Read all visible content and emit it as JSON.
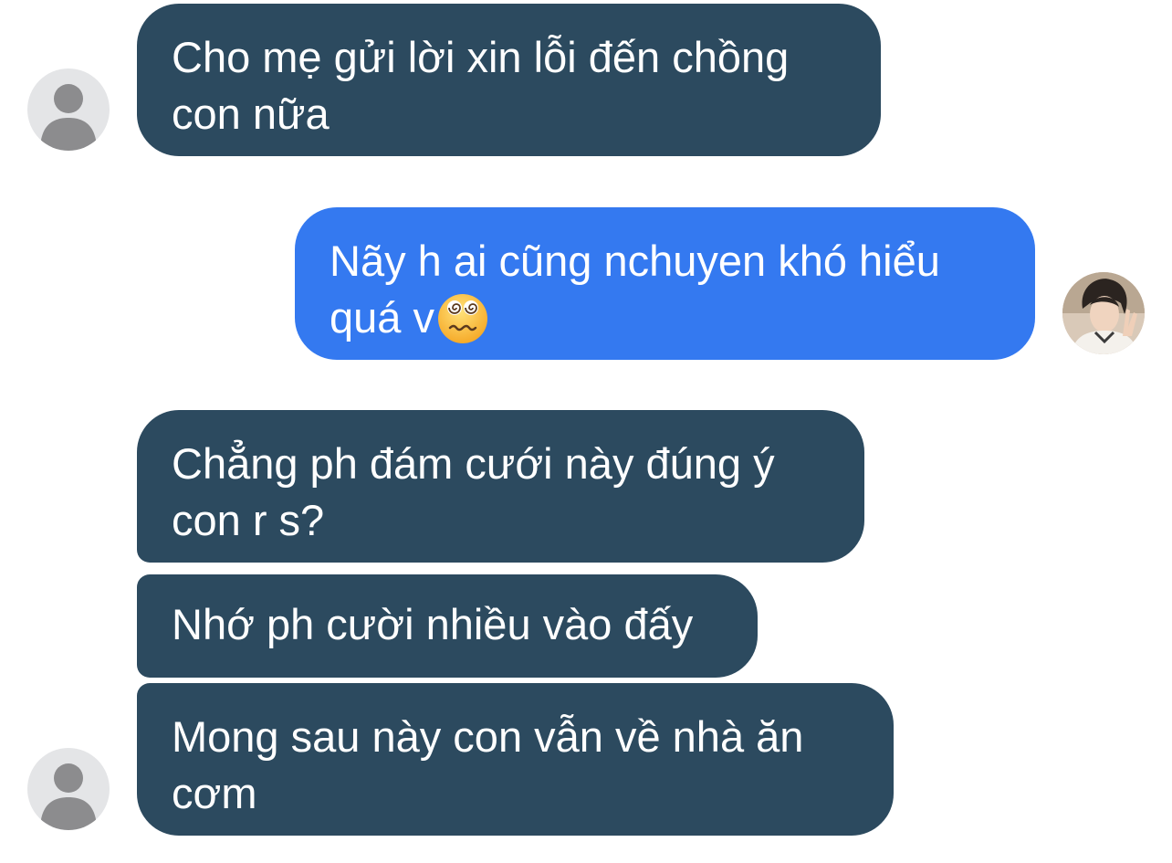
{
  "messages": [
    {
      "id": "m1",
      "direction": "received",
      "text": "Cho mẹ gửi lời xin lỗi đến chồng con nữa"
    },
    {
      "id": "m2",
      "direction": "sent",
      "text": "Nãy h ai cũng nchuyen khó hiểu quá v",
      "emoji": "dizzy-face-emoji"
    },
    {
      "id": "m3",
      "direction": "received",
      "text": "Chẳng ph đám cưới này đúng ý con r s?"
    },
    {
      "id": "m4",
      "direction": "received",
      "text": "Nhớ ph cười nhiều vào đấy"
    },
    {
      "id": "m5",
      "direction": "received",
      "text": "Mong sau này con vẫn về nhà ăn cơm"
    }
  ],
  "colors": {
    "received_bubble": "#2c4a5f",
    "sent_bubble": "#3479f0",
    "bubble_text": "#ffffff",
    "avatar_placeholder_bg": "#e4e5e7",
    "avatar_placeholder_fg": "#8c8c8e"
  },
  "icons": {
    "contact_avatar": "default-person-icon",
    "own_avatar": "user-photo-avatar"
  }
}
